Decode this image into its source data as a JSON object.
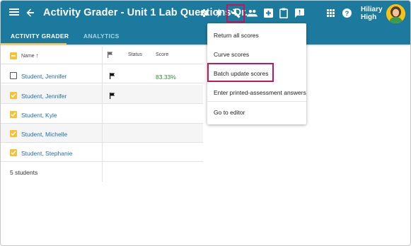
{
  "app_title": "Activity Grader - Unit 1 Lab Questions Dr...",
  "user": {
    "line1": "Hiliary",
    "line2": "High"
  },
  "icons": [
    "menu-icon",
    "back-arrow-icon",
    "settings-icon",
    "bolt-icon",
    "wrench-icon",
    "people-icon",
    "add-box-icon",
    "clipboard-icon",
    "feedback-icon",
    "apps-grid-icon",
    "help-icon",
    "avatar"
  ],
  "tabs": [
    {
      "label": "ACTIVITY GRADER"
    },
    {
      "label": "ANALYTICS"
    }
  ],
  "table": {
    "headers": {
      "name": "Name",
      "status": "Status",
      "score": "Score"
    },
    "rows": [
      {
        "name": "Student, Jennifer",
        "checked": false,
        "flagged": true,
        "score": "83.33%"
      },
      {
        "name": "Student, Jennifer",
        "checked": true,
        "flagged": true,
        "score": ""
      },
      {
        "name": "Student, Kyle",
        "checked": true,
        "flagged": false,
        "score": ""
      },
      {
        "name": "Student, Michelle",
        "checked": true,
        "flagged": false,
        "score": ""
      },
      {
        "name": "Student, Stephanie",
        "checked": true,
        "flagged": false,
        "score": ""
      }
    ],
    "footer": "5 students"
  },
  "menu": {
    "items": [
      {
        "label": "Return all scores"
      },
      {
        "label": "Curve scores"
      },
      {
        "label": "Batch update scores"
      },
      {
        "label": "Enter printed-assessment answers"
      },
      {
        "label": "Go to editor"
      }
    ]
  },
  "colors": {
    "appbar": "#1c7a9f",
    "accent": "#f6c234",
    "highlight": "#c2185b",
    "link": "#2070ad",
    "score": "#2f8a2f"
  }
}
